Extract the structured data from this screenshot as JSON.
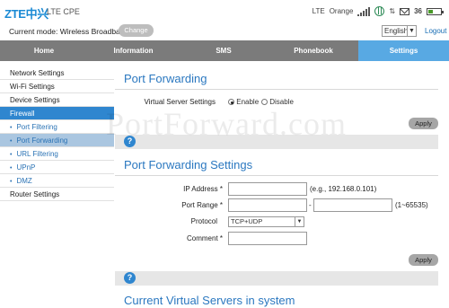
{
  "header": {
    "logo_text": "ZTE中兴",
    "product": "LTE CPE",
    "network_type": "LTE",
    "operator": "Orange",
    "signal_level": 4,
    "sms_count": "36",
    "battery_fraction": 0.4
  },
  "mode": {
    "label": "Current mode: Wireless Broadband",
    "change_label": "Change"
  },
  "language": {
    "selected": "English"
  },
  "logout_label": "Logout",
  "nav": {
    "tabs": [
      {
        "label": "Home"
      },
      {
        "label": "Information"
      },
      {
        "label": "SMS"
      },
      {
        "label": "Phonebook"
      },
      {
        "label": "Settings"
      }
    ],
    "active": "Settings"
  },
  "sidebar": {
    "items": [
      {
        "label": "Network Settings"
      },
      {
        "label": "Wi-Fi Settings"
      },
      {
        "label": "Device Settings"
      },
      {
        "label": "Firewall"
      },
      {
        "label": "Port Filtering"
      },
      {
        "label": "Port Forwarding"
      },
      {
        "label": "URL Filtering"
      },
      {
        "label": "UPnP"
      },
      {
        "label": "DMZ"
      },
      {
        "label": "Router Settings"
      }
    ]
  },
  "port_forwarding": {
    "title": "Port Forwarding",
    "virtual_server_label": "Virtual Server Settings",
    "enable_label": "Enable",
    "disable_label": "Disable",
    "selected": "Enable",
    "apply_label": "Apply"
  },
  "watermark": "PortForward.com",
  "pf_settings": {
    "title": "Port Forwarding Settings",
    "ip_label": "IP Address *",
    "ip_value": "",
    "ip_hint": "(e.g., 192.168.0.101)",
    "port_range_label": "Port Range *",
    "port_from": "",
    "port_to": "",
    "port_sep": "-",
    "port_hint": "(1~65535)",
    "protocol_label": "Protocol",
    "protocol_value": "TCP+UDP",
    "comment_label": "Comment *",
    "comment_value": "",
    "apply_label": "Apply"
  },
  "current_servers": {
    "title": "Current Virtual Servers in system"
  },
  "help_icon": "?",
  "colors": {
    "brand_blue": "#2f86cf",
    "nav_gray": "#7b7b7b",
    "nav_active": "#58a9e3",
    "title_blue": "#2b78c0"
  }
}
